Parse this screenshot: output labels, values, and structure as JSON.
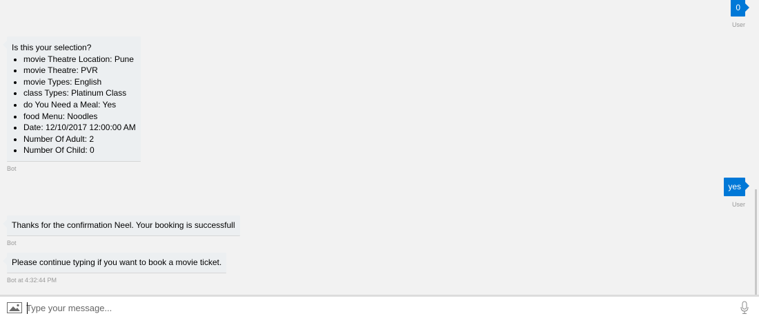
{
  "messages": {
    "user_zero": {
      "text": "0",
      "sender": "User"
    },
    "bot_selection": {
      "heading": "Is this your selection?",
      "items": [
        "movie Theatre Location: Pune",
        "movie Theatre: PVR",
        "movie Types: English",
        "class Types: Platinum Class",
        "do You Need a Meal: Yes",
        "food Menu: Noodles",
        "Date: 12/10/2017 12:00:00 AM",
        "Number Of Adult: 2",
        "Number Of Child: 0"
      ],
      "sender": "Bot"
    },
    "user_yes": {
      "text": "yes",
      "sender": "User"
    },
    "bot_confirm": {
      "text": "Thanks for the confirmation Neel. Your booking is successfull",
      "sender": "Bot"
    },
    "bot_continue": {
      "text": "Please continue typing if you want to book a movie ticket.",
      "sender": "Bot at 4:32:44 PM"
    }
  },
  "compose": {
    "placeholder": "Type your message...",
    "upload_icon": "image-icon",
    "mic_icon": "microphone-icon"
  },
  "colors": {
    "user_bubble": "#0078d7",
    "bot_bubble": "#eceff1",
    "background": "#f2f2f2"
  }
}
